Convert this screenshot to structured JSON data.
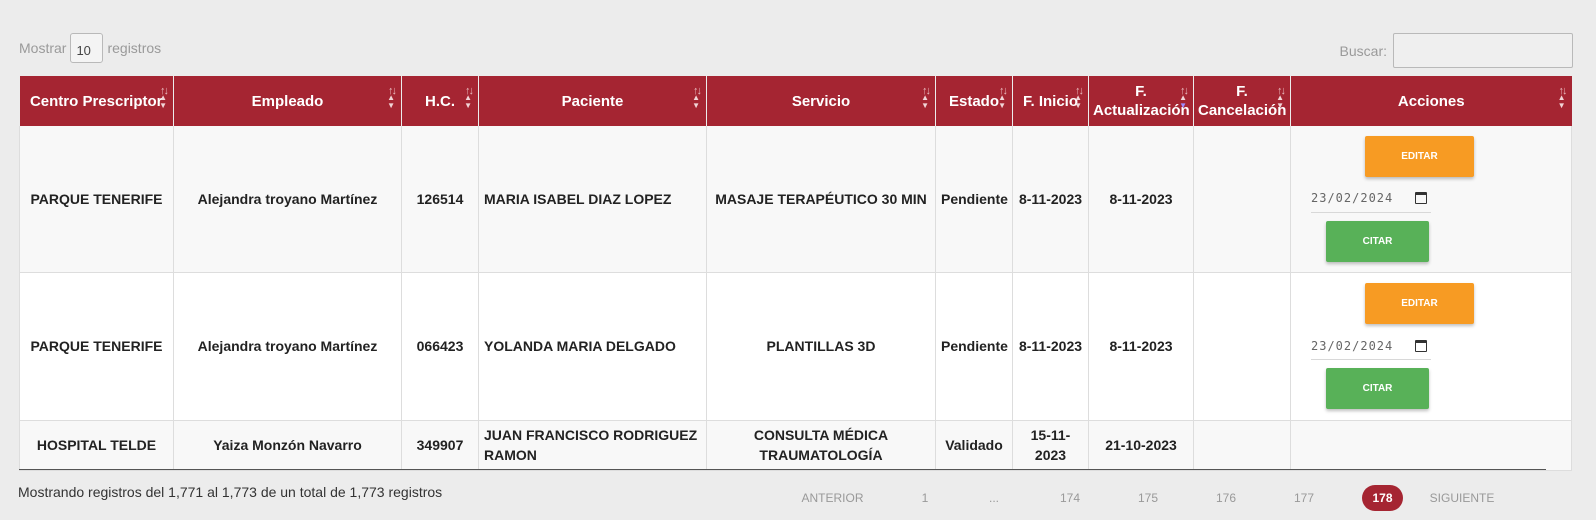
{
  "controls": {
    "show_label": "Mostrar",
    "length_value": "10",
    "records_label": "registros",
    "search_label": "Buscar:",
    "search_value": ""
  },
  "columns": [
    {
      "key": "centro",
      "label": "Centro Prescriptor"
    },
    {
      "key": "empleado",
      "label": "Empleado"
    },
    {
      "key": "hc",
      "label": "H.C."
    },
    {
      "key": "paciente",
      "label": "Paciente"
    },
    {
      "key": "servicio",
      "label": "Servicio"
    },
    {
      "key": "estado",
      "label": "Estado"
    },
    {
      "key": "inicio",
      "label": "F. Inicio"
    },
    {
      "key": "actualizacion",
      "label": "F. Actualización"
    },
    {
      "key": "cancelacion",
      "label": "F. Cancelación"
    },
    {
      "key": "acciones",
      "label": "Acciones"
    }
  ],
  "rows": [
    {
      "centro": "PARQUE TENERIFE",
      "empleado": "Alejandra troyano Martínez",
      "hc": "126514",
      "paciente": "MARIA ISABEL DIAZ LOPEZ",
      "servicio": "MASAJE TERAPÉUTICO 30 MIN",
      "estado": "Pendiente",
      "inicio": "8-11-2023",
      "actualizacion": "8-11-2023",
      "cancelacion": "",
      "edit_label": "EDITAR",
      "date_value": "23/02/2024",
      "cite_label": "CITAR"
    },
    {
      "centro": "PARQUE TENERIFE",
      "empleado": "Alejandra troyano Martínez",
      "hc": "066423",
      "paciente": "YOLANDA MARIA DELGADO",
      "servicio": "PLANTILLAS 3D",
      "estado": "Pendiente",
      "inicio": "8-11-2023",
      "actualizacion": "8-11-2023",
      "cancelacion": "",
      "edit_label": "EDITAR",
      "date_value": "23/02/2024",
      "cite_label": "CITAR"
    },
    {
      "centro": "HOSPITAL TELDE",
      "empleado": "Yaiza Monzón Navarro",
      "hc": "349907",
      "paciente": "JUAN FRANCISCO RODRIGUEZ RAMON",
      "servicio": "CONSULTA MÉDICA TRAUMATOLOGÍA",
      "estado": "Validado",
      "inicio": "15-11-2023",
      "actualizacion": "21-10-2023",
      "cancelacion": ""
    }
  ],
  "footer": {
    "info": "Mostrando registros del 1,771 al 1,773 de un total de 1,773 registros",
    "pagination": [
      "ANTERIOR",
      "1",
      "...",
      "174",
      "175",
      "176",
      "177",
      "178",
      "SIGUIENTE"
    ],
    "current_page": "178"
  },
  "colors": {
    "header_bg": "#a52532",
    "edit_button": "#f79b23",
    "cite_button": "#58b158",
    "current_page": "#a52532"
  },
  "icons": {
    "sort": "sort-arrows-icon",
    "calendar": "calendar-icon"
  }
}
